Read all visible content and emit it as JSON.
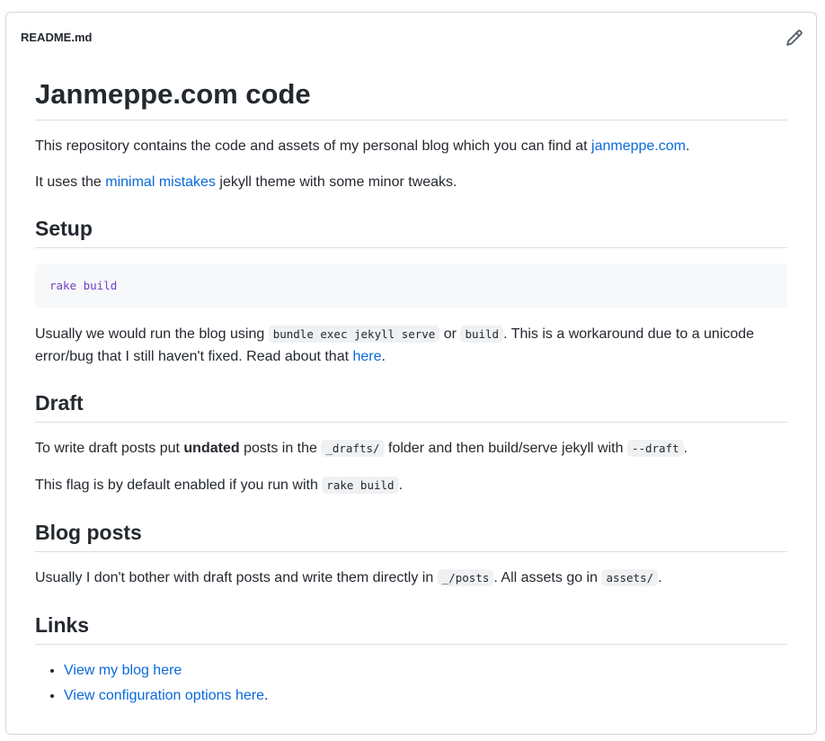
{
  "header": {
    "filename": "README.md",
    "edit_icon": "pencil-icon"
  },
  "readme": {
    "title": "Janmeppe.com code",
    "intro": {
      "before": "This repository contains the code and assets of my personal blog which you can find at ",
      "link": "janmeppe.com",
      "after": "."
    },
    "theme": {
      "before": "It uses the ",
      "link": "minimal mistakes",
      "after": " jekyll theme with some minor tweaks."
    },
    "setup": {
      "heading": "Setup",
      "code": "rake build",
      "p_before": "Usually we would run the blog using ",
      "code1": "bundle exec jekyll serve",
      "p_mid": " or ",
      "code2": "build",
      "p_after": ". This is a workaround due to a unicode error/bug that I still haven't fixed. Read about that ",
      "link": "here",
      "p_end": "."
    },
    "draft": {
      "heading": "Draft",
      "p1_before": "To write draft posts put ",
      "p1_bold": "undated",
      "p1_mid": " posts in the ",
      "p1_code": "_drafts/",
      "p1_mid2": " folder and then build/serve jekyll with ",
      "p1_code2": "--draft",
      "p1_end": ".",
      "p2_before": "This flag is by default enabled if you run with ",
      "p2_code": "rake build",
      "p2_end": "."
    },
    "blog_posts": {
      "heading": "Blog posts",
      "p_before": "Usually I don't bother with draft posts and write them directly in ",
      "code1": "_/posts",
      "p_mid": ". All assets go in ",
      "code2": "assets/",
      "p_end": "."
    },
    "links": {
      "heading": "Links",
      "items": [
        {
          "link": "View my blog here",
          "after": ""
        },
        {
          "link": "View configuration options here",
          "after": "."
        }
      ]
    }
  },
  "colors": {
    "link": "#0969da",
    "text": "#24292f",
    "border": "#d0d7de",
    "code_bg": "#f6f8fa"
  }
}
